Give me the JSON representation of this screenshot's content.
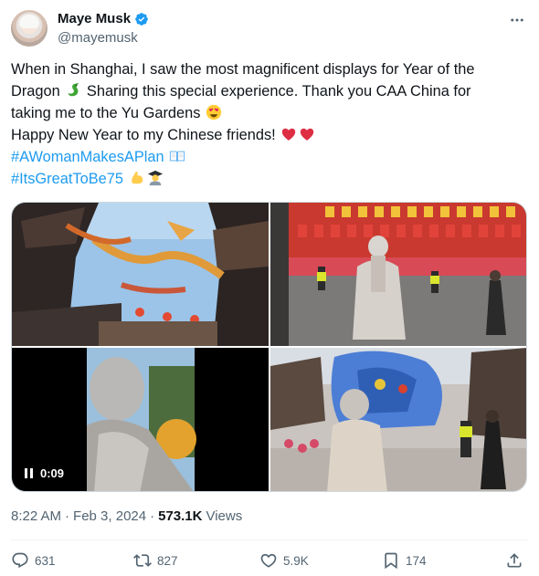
{
  "author": {
    "name": "Maye Musk",
    "handle": "@mayemusk",
    "verified": true
  },
  "icons": {
    "verified": "verified-badge-icon",
    "more": "more-dots-icon",
    "reply": "reply-icon",
    "retweet": "retweet-icon",
    "like": "heart-icon",
    "bookmark": "bookmark-icon",
    "share": "share-icon",
    "pause": "pause-icon"
  },
  "tweet": {
    "line1": "When in Shanghai, I saw the most magnificent displays for Year of the",
    "line2_a": "Dragon",
    "line2_b": "Sharing this special experience. Thank you CAA China for",
    "line3": "taking me to the Yu Gardens",
    "line4": "Happy New Year to my Chinese friends!",
    "hashtag1": "#AWomanMakesAPlan",
    "hashtag2": "#ItsGreatToBe75",
    "emojis": [
      "dragon",
      "heart-eyes",
      "red-heart",
      "red-heart",
      "open-book",
      "flexed-biceps",
      "graduate"
    ]
  },
  "media": {
    "video_time": "0:09",
    "images": [
      "yu-garden-dragon-lanterns",
      "woman-in-front-of-lantern-wall",
      "woman-filming-video",
      "woman-photographing-blue-dragon"
    ]
  },
  "meta": {
    "time": "8:22 AM",
    "separator": "·",
    "date": "Feb 3, 2024",
    "separator2": "·",
    "views_count": "573.1K",
    "views_label": "Views"
  },
  "actions": {
    "replies": "631",
    "retweets": "827",
    "likes": "5.9K",
    "bookmarks": "174"
  },
  "colors": {
    "text": "#0f1419",
    "secondary": "#536471",
    "link": "#1d9bf0",
    "border": "#cfd9de"
  }
}
